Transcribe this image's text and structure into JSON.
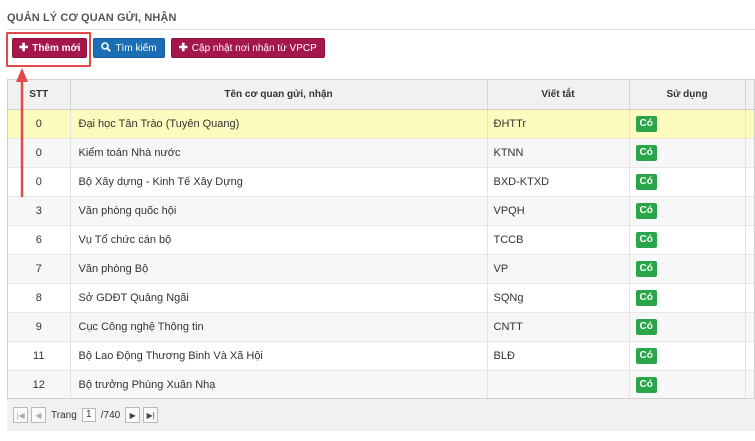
{
  "page": {
    "title": "QUẢN LÝ CƠ QUAN GỬI, NHẬN"
  },
  "toolbar": {
    "add_label": "Thêm mới",
    "search_label": "Tìm kiếm",
    "sync_label": "Cập nhật nơi nhận từ VPCP"
  },
  "table": {
    "headers": {
      "stt": "STT",
      "name": "Tên cơ quan gửi, nhận",
      "abbr": "Viết tắt",
      "use": "Sử dụng"
    },
    "rows": [
      {
        "stt": "0",
        "name": "Đại học Tân Trào (Tuyên Quang)",
        "abbr": "ĐHTTr",
        "use": "Có",
        "selected": true
      },
      {
        "stt": "0",
        "name": "Kiểm toán Nhà nước",
        "abbr": "KTNN",
        "use": "Có"
      },
      {
        "stt": "0",
        "name": "Bộ Xây dựng - Kinh Tế Xây Dựng",
        "abbr": "BXD-KTXD",
        "use": "Có"
      },
      {
        "stt": "3",
        "name": "Văn phòng quốc hội",
        "abbr": "VPQH",
        "use": "Có"
      },
      {
        "stt": "6",
        "name": "Vụ Tổ chức cán bộ",
        "abbr": "TCCB",
        "use": "Có"
      },
      {
        "stt": "7",
        "name": "Văn phòng Bộ",
        "abbr": "VP",
        "use": "Có"
      },
      {
        "stt": "8",
        "name": "Sở GDĐT Quảng Ngãi",
        "abbr": "SQNg",
        "use": "Có"
      },
      {
        "stt": "9",
        "name": "Cục Công nghệ Thông tin",
        "abbr": "CNTT",
        "use": "Có"
      },
      {
        "stt": "11",
        "name": "Bộ Lao Động Thương Binh Và Xã Hội",
        "abbr": "BLĐ",
        "use": "Có"
      },
      {
        "stt": "12",
        "name": "Bộ trưởng Phùng Xuân Nhạ",
        "abbr": "",
        "use": "Có"
      }
    ]
  },
  "pager": {
    "page_label": "Trang",
    "current_page": "1",
    "total_pages": "/740"
  },
  "colors": {
    "primary_maroon": "#a5174a",
    "search_blue": "#1d6fb5",
    "badge_green": "#2aa54a",
    "highlight_red": "#e04a4a",
    "selected_row": "#fdfbbd"
  }
}
